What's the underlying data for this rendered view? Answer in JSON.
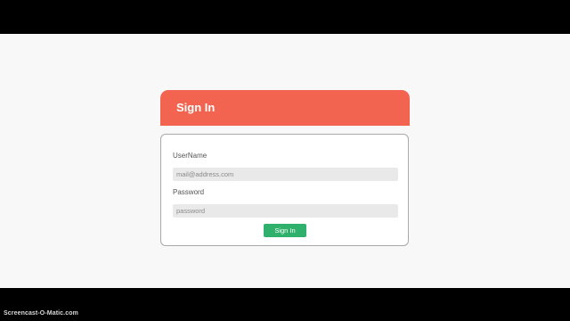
{
  "login": {
    "title": "Sign In",
    "username_label": "UserName",
    "username_placeholder": "mail@address.com",
    "password_label": "Password",
    "password_placeholder": "password",
    "submit_label": "Sign In"
  },
  "watermark": "Screencast-O-Matic.com",
  "colors": {
    "header": "#f26450",
    "button": "#2fb06b",
    "field": "#e9e9e9",
    "page": "#f8f8f8"
  }
}
